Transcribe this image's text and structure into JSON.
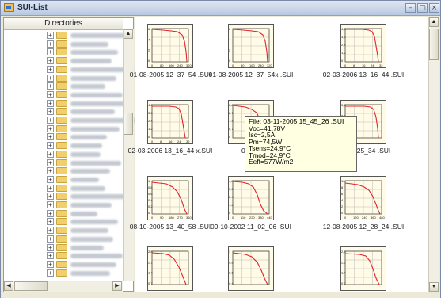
{
  "window": {
    "title": "SUI-List"
  },
  "titlebar_buttons": [
    "minimize",
    "maximize",
    "close"
  ],
  "left_panel": {
    "header": "Directories",
    "tree_row_count": 29
  },
  "thumbnails": [
    {
      "caption": "01-08-2005  12_37_54 .SUI",
      "y_ticks": [
        "6",
        "4",
        "2",
        "0"
      ],
      "x_ticks": [
        "0",
        "80",
        "160",
        "240",
        "320"
      ]
    },
    {
      "caption": "01-08-2005  12_37_54x .SUI",
      "y_ticks": [
        "6",
        "4",
        "2",
        "0"
      ],
      "x_ticks": [
        "0",
        "80",
        "160",
        "240",
        "320"
      ]
    },
    {
      "caption": "02-03-2006  13_16_44 .SUI",
      "y_ticks": [
        "4,2",
        "3,6",
        "2,4",
        "1,2",
        "0"
      ],
      "x_ticks": [
        "0",
        "8",
        "16",
        "24",
        "32"
      ]
    },
    {
      "caption": "02-03-2006  13_16_44 x.SUI",
      "y_ticks": [
        "4,2",
        "3,6",
        "2,4",
        "1,2",
        "0"
      ],
      "x_ticks": [
        "0",
        "8",
        "16",
        "24",
        "32"
      ]
    },
    {
      "caption": "03-11-",
      "y_ticks": [
        "2,8",
        "2,1",
        "1,4",
        "0,7",
        "0"
      ],
      "x_ticks": []
    },
    {
      "caption": "05  15_25_34 .SUI",
      "y_ticks": [
        "3,6",
        "2,4",
        "1,2",
        "0"
      ],
      "x_ticks": []
    },
    {
      "caption": "08-10-2005  13_40_58 .SUI",
      "y_ticks": [
        "1",
        "0,8",
        "0,6",
        "0,4",
        "0,2",
        "0"
      ],
      "x_ticks": [
        "0",
        "90",
        "180",
        "270",
        "360"
      ]
    },
    {
      "caption": "09-10-2002  11_02_06 .SUI",
      "y_ticks": [
        "4,8",
        "3,6",
        "2,4",
        "1,2",
        "0"
      ],
      "x_ticks": [
        "0",
        "110",
        "220",
        "330",
        "440"
      ]
    },
    {
      "caption": "12-08-2005  12_28_24 .SUI",
      "y_ticks": [
        "10",
        "8",
        "6",
        "4",
        "2",
        "0"
      ],
      "x_ticks": [
        "0",
        "120",
        "240",
        "360",
        "480"
      ]
    },
    {
      "caption": "",
      "y_ticks": [
        "2,8",
        "2,1",
        "1,4",
        "0,7"
      ],
      "x_ticks": []
    },
    {
      "caption": "",
      "y_ticks": [
        "1",
        "0,8",
        "0,6",
        "0,4"
      ],
      "x_ticks": []
    },
    {
      "caption": "",
      "y_ticks": [
        "2,8",
        "2,1",
        "1,4",
        "0,7"
      ],
      "x_ticks": []
    }
  ],
  "tooltip": {
    "file": "File: 03-11-2005  15_45_26 .SUI",
    "voc": "Voc=41,78V",
    "isc": "Isc=2,5A",
    "pm": "Pm=74,5W",
    "tsens": "Tsens=24,9°C",
    "tmod": "Tmod=24,9°C",
    "eeff": "Eeff=577W/m2"
  },
  "colors": {
    "curve": "#e2222a",
    "thumb_bg": "#fffbe6",
    "window_chrome": "#ece9d8"
  }
}
